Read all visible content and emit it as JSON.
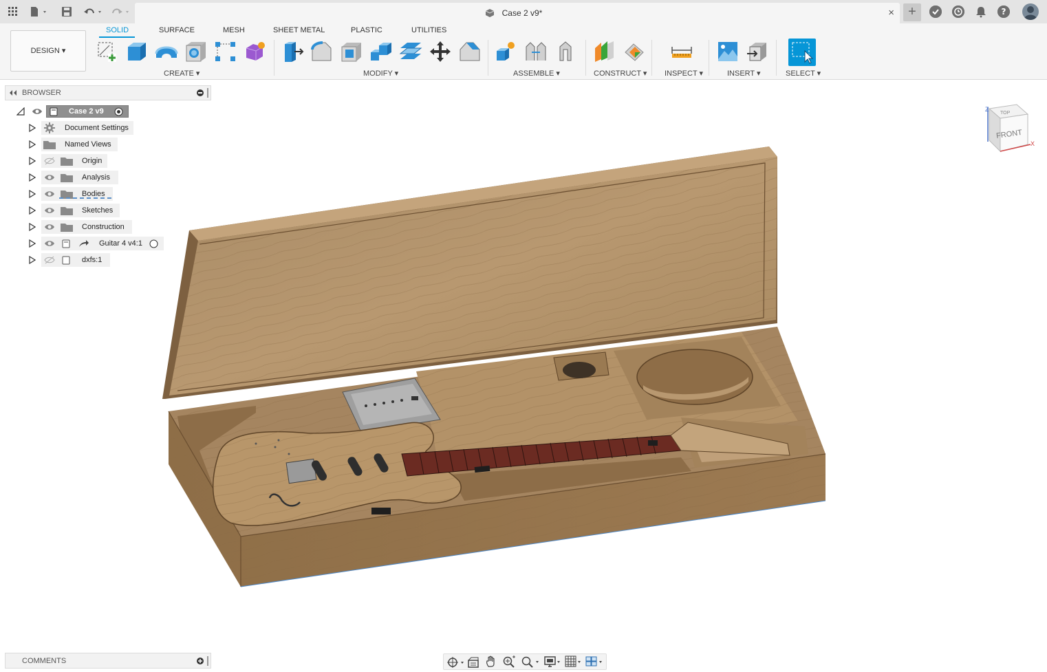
{
  "titlebar": {
    "document_title": "Case 2 v9*",
    "close_glyph": "×",
    "new_tab_glyph": "+"
  },
  "toolbar": {
    "workspace": "DESIGN",
    "tabs": [
      "SOLID",
      "SURFACE",
      "MESH",
      "SHEET METAL",
      "PLASTIC",
      "UTILITIES"
    ],
    "active_tab": "SOLID",
    "groups": {
      "create": "CREATE",
      "modify": "MODIFY",
      "assemble": "ASSEMBLE",
      "construct": "CONSTRUCT",
      "inspect": "INSPECT",
      "insert": "INSERT",
      "select": "SELECT"
    },
    "dropdown_glyph": "▾"
  },
  "browser": {
    "title": "BROWSER",
    "root": "Case 2 v9",
    "items": [
      {
        "label": "Document Settings"
      },
      {
        "label": "Named Views"
      },
      {
        "label": "Origin"
      },
      {
        "label": "Analysis"
      },
      {
        "label": "Bodies"
      },
      {
        "label": "Sketches"
      },
      {
        "label": "Construction"
      },
      {
        "label": "Guitar 4 v4:1"
      },
      {
        "label": "dxfs:1"
      }
    ]
  },
  "comments": {
    "title": "COMMENTS"
  },
  "viewcube": {
    "front": "FRONT",
    "top": "TOP",
    "axis_z": "Z",
    "axis_x": "X"
  },
  "colors": {
    "accent": "#0696d7",
    "wood_light": "#b89870",
    "wood_dark": "#8a6a44",
    "fretboard": "#6b2b22"
  }
}
